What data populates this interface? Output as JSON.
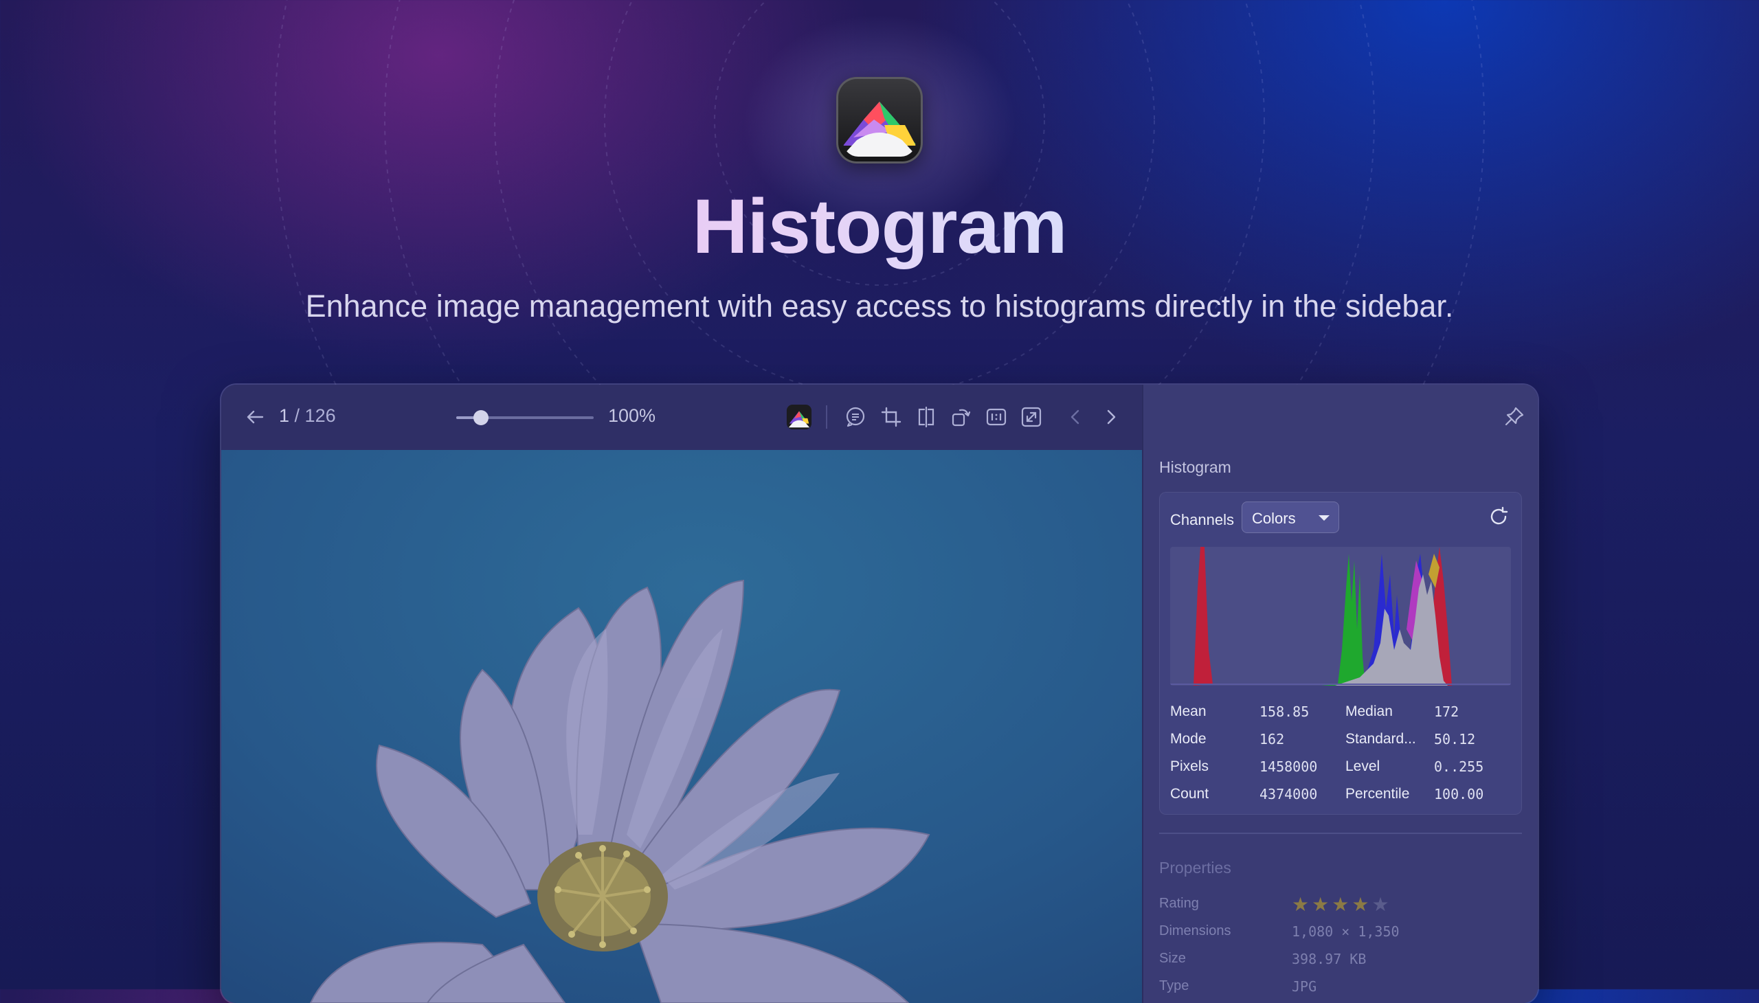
{
  "hero": {
    "title": "Histogram",
    "subtitle": "Enhance image management with easy access to histograms directly in the sidebar."
  },
  "toolbar": {
    "counter_current": "1",
    "counter_sep": " / ",
    "counter_total": "126",
    "zoom_level": "100%",
    "zoom_slider_fraction": 0.18,
    "icons": [
      "back-arrow-icon",
      "histogram-app-icon",
      "comment-icon",
      "crop-icon",
      "compare-icon",
      "rotate-icon",
      "actual-size-icon",
      "fullscreen-icon",
      "previous-icon",
      "next-icon"
    ]
  },
  "sidebar": {
    "histogram_title": "Histogram",
    "channels_label": "Channels",
    "channels_value": "Colors",
    "stats": [
      {
        "label": "Mean",
        "value": "158.85",
        "label2": "Median",
        "value2": "172"
      },
      {
        "label": "Mode",
        "value": "162",
        "label2": "Standard...",
        "value2": "50.12"
      },
      {
        "label": "Pixels",
        "value": "1458000",
        "label2": "Level",
        "value2": "0..255"
      },
      {
        "label": "Count",
        "value": "4374000",
        "label2": "Percentile",
        "value2": "100.00"
      }
    ],
    "properties_title": "Properties",
    "properties": [
      {
        "label": "Rating",
        "value": ""
      },
      {
        "label": "Dimensions",
        "value": "1,080 × 1,350"
      },
      {
        "label": "Size",
        "value": "398.97 KB"
      },
      {
        "label": "Type",
        "value": "JPG"
      }
    ],
    "rating": 4,
    "rating_max": 5
  },
  "colors": {
    "red_channel": "#c0203a",
    "green_channel": "#1fa82e",
    "blue_channel": "#2a2ad0",
    "luminance": "#a7a7b8"
  }
}
